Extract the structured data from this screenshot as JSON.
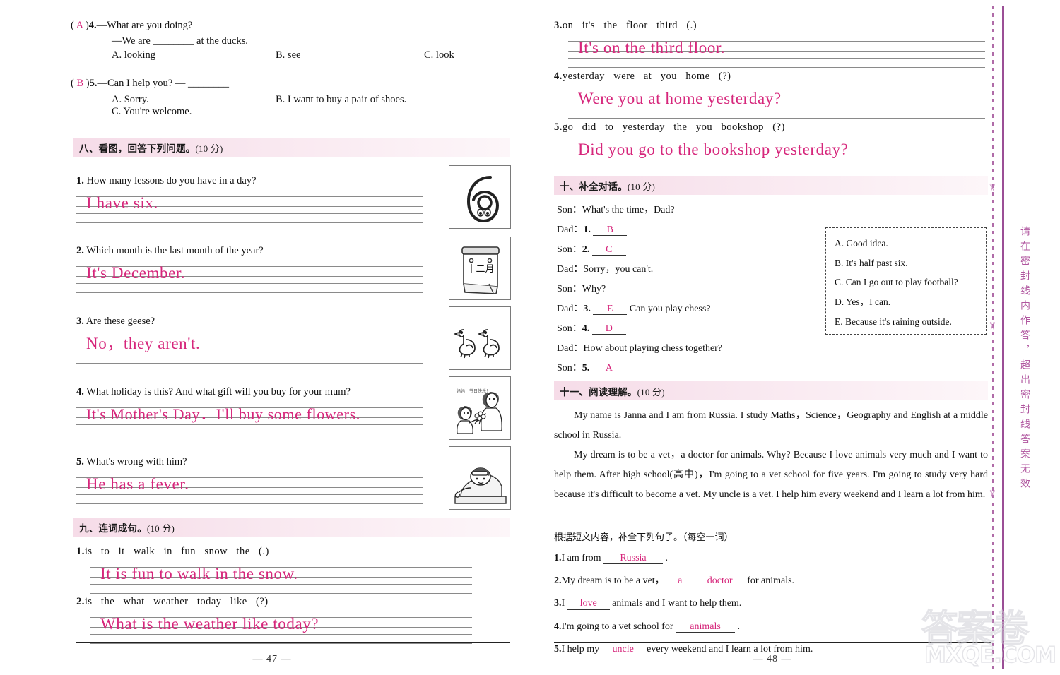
{
  "meta": {
    "seal_text": "请在密封线内作答，超出密封线答案无效",
    "watermark_cn": "答案卷",
    "watermark_en": "MXQE.COM",
    "ink_color": "#d6267b",
    "header_pink": "#f6dce8"
  },
  "left_page": {
    "page_number": "— 47 —",
    "mc_continued": [
      {
        "bracket": "( A )",
        "num": "4.",
        "stem": "—What are you doing?",
        "stem2": "—We are ________ at the ducks.",
        "options": [
          "A. looking",
          "B. see",
          "C. look"
        ]
      },
      {
        "bracket": "( B )",
        "num": "5.",
        "stem": "—Can I help you?    — ________",
        "options": [
          "A. Sorry.",
          "B. I want to buy a pair of shoes.",
          "C. You're welcome."
        ]
      }
    ],
    "section8": {
      "title": "八、看图，回答下列问题。",
      "points": "(10 分)",
      "items": [
        {
          "num": "1.",
          "question": "How many lessons do you have in a day?",
          "answer": "I have six.",
          "picture": "number-six-cartoon"
        },
        {
          "num": "2.",
          "question": "Which month is the last month of the year?",
          "answer": "It's December.",
          "picture": "calendar-december"
        },
        {
          "num": "3.",
          "question": "Are these geese?",
          "answer": "No，they aren't.",
          "picture": "two-geese"
        },
        {
          "num": "4.",
          "question": "What holiday is this?  And what gift will you buy for your mum?",
          "answer": "It's Mother's Day．I'll buy some flowers.",
          "picture": "boy-giving-flowers-to-mother"
        },
        {
          "num": "5.",
          "question": "What's wrong with him?",
          "answer": "He has a fever.",
          "picture": "sick-boy-in-bed"
        }
      ]
    },
    "section9": {
      "title": "九、连词成句。",
      "points": "(10 分)",
      "items": [
        {
          "num": "1.",
          "words": "is   to   it   walk   in   fun   snow   the   (.)",
          "answer": "It is fun to walk in the snow."
        },
        {
          "num": "2.",
          "words": "is   the   what   weather   today   like   (?)",
          "answer": "What is the weather like today?"
        }
      ]
    }
  },
  "right_page": {
    "page_number": "— 48 —",
    "section9_cont": {
      "items": [
        {
          "num": "3.",
          "words": "on   it's   the   floor   third   (.)",
          "answer": "It's on the third floor."
        },
        {
          "num": "4.",
          "words": "yesterday   were   at   you   home   (?)",
          "answer": "Were you at home yesterday?"
        },
        {
          "num": "5.",
          "words": "go   did   to   yesterday   the   you   bookshop   (?)",
          "answer": "Did you go to the bookshop yesterday?"
        }
      ]
    },
    "section10": {
      "title": "十、补全对话。",
      "points": "(10 分)",
      "lines": [
        {
          "speaker": "Son：",
          "text": "What's the time，Dad?",
          "blank": null,
          "num": null
        },
        {
          "speaker": "Dad：",
          "text": "",
          "num": "1.",
          "blank": "B"
        },
        {
          "speaker": "Son：",
          "text": "",
          "num": "2.",
          "blank": "C"
        },
        {
          "speaker": "Dad：",
          "text": "Sorry，you can't.",
          "blank": null,
          "num": null
        },
        {
          "speaker": "Son：",
          "text": "Why?",
          "blank": null,
          "num": null
        },
        {
          "speaker": "Dad：",
          "text": "Can you play chess?",
          "num": "3.",
          "blank": "E"
        },
        {
          "speaker": "Son：",
          "text": "",
          "num": "4.",
          "blank": "D"
        },
        {
          "speaker": "Dad：",
          "text": "How about playing chess together?",
          "blank": null,
          "num": null
        },
        {
          "speaker": "Son：",
          "text": "",
          "num": "5.",
          "blank": "A"
        }
      ],
      "options": [
        "A. Good idea.",
        "B. It's half past six.",
        "C. Can I go out to play football?",
        "D. Yes，I can.",
        "E. Because it's raining outside."
      ]
    },
    "section11": {
      "title": "十一、阅读理解。",
      "points": "(10 分)",
      "paragraphs": [
        "My name is Janna and I am from Russia. I study Maths，Science，Geography and English at a middle school in Russia.",
        "My dream is to be a vet，a doctor for animals. Why? Because I love animals very much and I want to help them. After high school(高中)，I'm going to a vet school for five years. I'm going to study very hard because it's difficult to become a vet. My uncle is a vet. I help him every weekend and I learn a lot from him."
      ],
      "instruction": "根据短文内容，补全下列句子。（每空一词）",
      "questions": [
        {
          "num": "1.",
          "before": "I am from",
          "answers": [
            "Russia"
          ],
          "after": "."
        },
        {
          "num": "2.",
          "before": "My dream is to be a vet，",
          "answers": [
            "a",
            "doctor"
          ],
          "after": "for animals."
        },
        {
          "num": "3.",
          "before": "I",
          "answers": [
            "love"
          ],
          "after": "animals and I want to help them."
        },
        {
          "num": "4.",
          "before": "I'm going to a vet school for",
          "answers": [
            "animals"
          ],
          "after": "."
        },
        {
          "num": "5.",
          "before": "I help my",
          "answers": [
            "uncle"
          ],
          "after": "every weekend and I learn a lot from him."
        }
      ]
    }
  }
}
